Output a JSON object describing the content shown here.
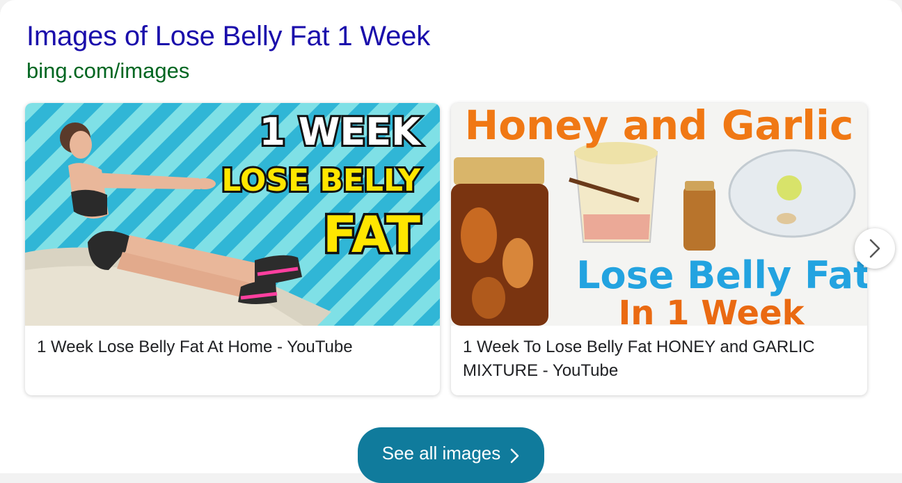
{
  "result": {
    "title": "Images of Lose Belly Fat 1 Week",
    "source": "bing.com/images"
  },
  "cards": [
    {
      "thumb_text": [
        "1 WEEK",
        "LOSE BELLY",
        "FAT"
      ],
      "caption": "1 Week Lose Belly Fat At Home - YouTube"
    },
    {
      "thumb_text": [
        "Honey and Garlic",
        "Lose Belly Fat",
        "In 1 Week"
      ],
      "caption": "1 Week To Lose Belly Fat HONEY and GARLIC MIXTURE - YouTube"
    }
  ],
  "carousel": {
    "next_icon": "chevron-right-icon"
  },
  "see_all": {
    "label": "See all images",
    "icon": "chevron-right-icon"
  },
  "colors": {
    "title": "#1a0dab",
    "source": "#006621",
    "button": "#107b9c",
    "card1_bg": "#3cc0d8",
    "card1_yellow": "#ffe600",
    "card2_orange": "#f07814",
    "card2_blue": "#23a3e0"
  }
}
